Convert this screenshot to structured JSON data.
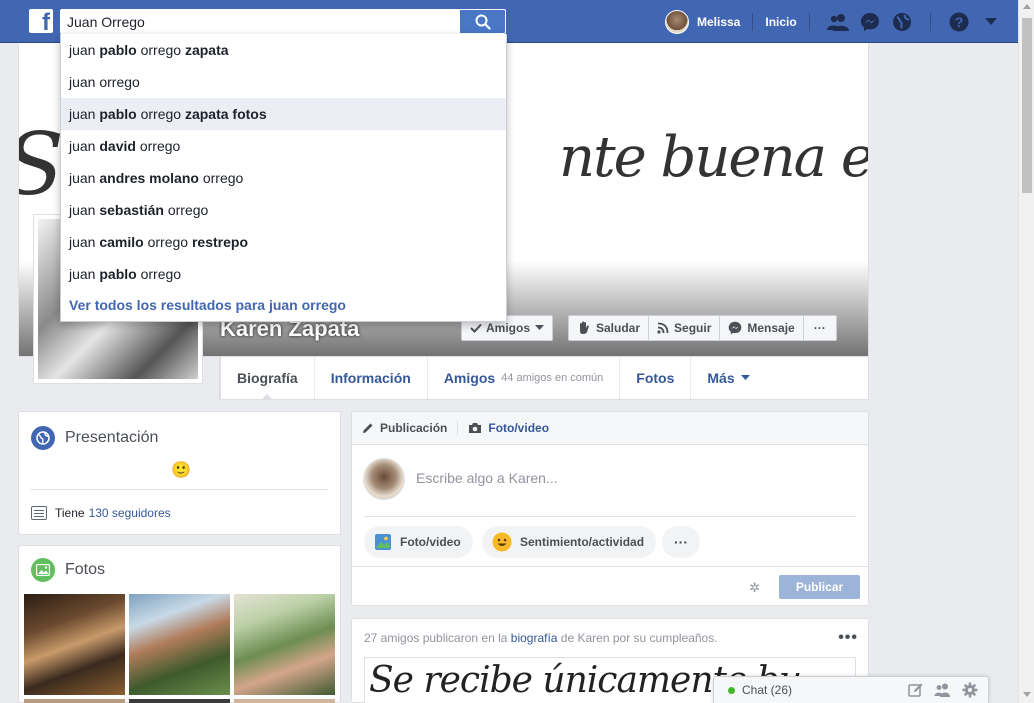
{
  "search": {
    "value": "Juan Orrego",
    "suggestions": [
      [
        {
          "t": "juan ",
          "b": false
        },
        {
          "t": "pablo",
          "b": true
        },
        {
          "t": " orrego ",
          "b": false
        },
        {
          "t": "zapata",
          "b": true
        }
      ],
      [
        {
          "t": "juan orrego",
          "b": false
        }
      ],
      [
        {
          "t": "juan ",
          "b": false
        },
        {
          "t": "pablo",
          "b": true
        },
        {
          "t": " orrego ",
          "b": false
        },
        {
          "t": "zapata fotos",
          "b": true
        }
      ],
      [
        {
          "t": "juan ",
          "b": false
        },
        {
          "t": "david",
          "b": true
        },
        {
          "t": " orrego",
          "b": false
        }
      ],
      [
        {
          "t": "juan ",
          "b": false
        },
        {
          "t": "andres molano",
          "b": true
        },
        {
          "t": " orrego",
          "b": false
        }
      ],
      [
        {
          "t": "juan ",
          "b": false
        },
        {
          "t": "sebastián",
          "b": true
        },
        {
          "t": " orrego",
          "b": false
        }
      ],
      [
        {
          "t": "juan ",
          "b": false
        },
        {
          "t": "camilo",
          "b": true
        },
        {
          "t": " orrego ",
          "b": false
        },
        {
          "t": "restrepo",
          "b": true
        }
      ],
      [
        {
          "t": "juan ",
          "b": false
        },
        {
          "t": "pablo",
          "b": true
        },
        {
          "t": " orrego",
          "b": false
        }
      ]
    ],
    "highlighted_index": 2,
    "see_all": "Ver todos los resultados para juan orrego"
  },
  "nav": {
    "user_name": "Melissa",
    "home": "Inicio"
  },
  "cover": {
    "text_left": "Se",
    "text_right": "nte buena energía"
  },
  "profile": {
    "name": "Karen Zapata",
    "friends_btn": "Amigos",
    "greet_btn": "Saludar",
    "follow_btn": "Seguir",
    "message_btn": "Mensaje",
    "more_btn": "···"
  },
  "tabs": {
    "bio": "Biografía",
    "info": "Información",
    "friends": "Amigos",
    "friends_sub": "44 amigos en común",
    "photos": "Fotos",
    "more": "Más"
  },
  "intro": {
    "title": "Presentación",
    "emoji": "🙂",
    "followers_prefix": "Tiene",
    "followers_link": "130 seguidores"
  },
  "photos_card": {
    "title": "Fotos"
  },
  "composer": {
    "tab_post": "Publicación",
    "tab_photo": "Foto/video",
    "placeholder": "Escribe algo a Karen...",
    "pill_photo": "Foto/video",
    "pill_feeling": "Sentimiento/actividad",
    "pill_more": "···",
    "publish": "Publicar"
  },
  "post": {
    "text_a": "27 amigos publicaron en la ",
    "text_link": "biografía",
    "text_b": " de Karen por su cumpleaños.",
    "image_text": "Se   recibe únicamente bu"
  },
  "chat": {
    "label": "Chat (26)"
  },
  "colors": {
    "brand": "#4267b2",
    "link": "#365899",
    "online": "#42b72a"
  }
}
